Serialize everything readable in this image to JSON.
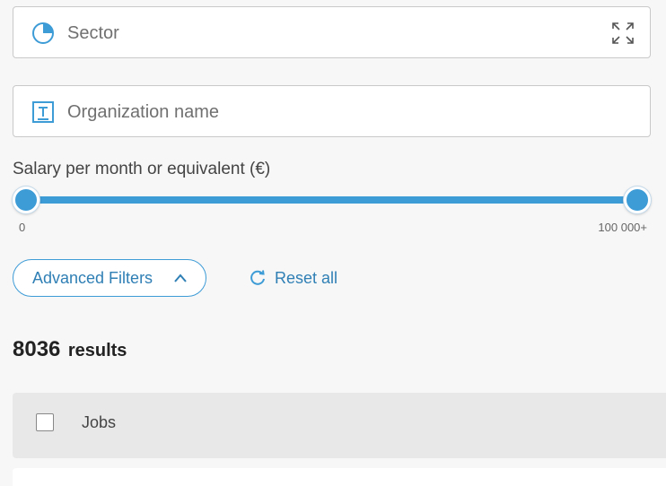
{
  "filters": {
    "sector": {
      "placeholder": "Sector",
      "icon": "pie-chart-icon",
      "expand_icon": "expand-icon"
    },
    "organization": {
      "placeholder": "Organization name",
      "icon": "text-field-icon"
    }
  },
  "salary": {
    "label": "Salary per month or equivalent (€)",
    "min_label": "0",
    "max_label": "100 000+",
    "range_selected": [
      0,
      100000
    ],
    "accent_color": "#3d9bd6"
  },
  "actions": {
    "advanced_filters_label": "Advanced Filters",
    "reset_label": "Reset all"
  },
  "results": {
    "count": "8036",
    "label": "results"
  },
  "categories": [
    {
      "label": "Jobs",
      "checked": false
    }
  ]
}
